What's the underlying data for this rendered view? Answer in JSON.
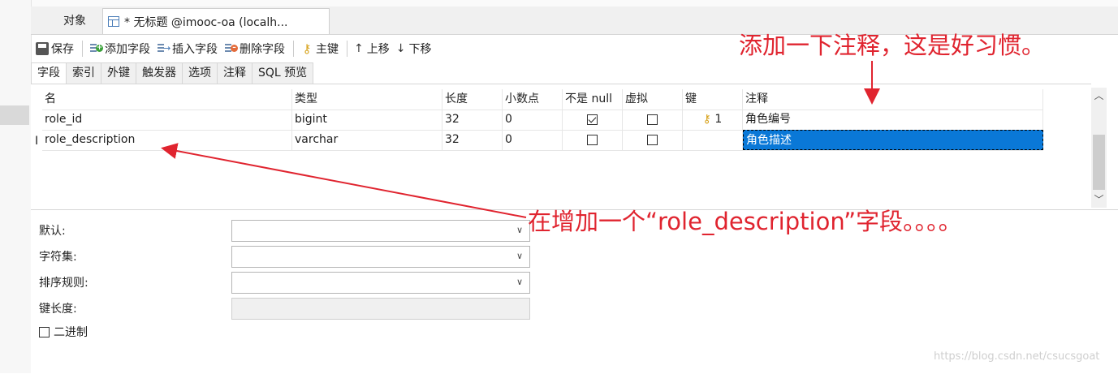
{
  "tabs": {
    "objects_label": "对象",
    "document_label": "* 无标题 @imooc-oa (localh..."
  },
  "toolbar": {
    "save": "保存",
    "add_field": "添加字段",
    "insert_field": "插入字段",
    "delete_field": "删除字段",
    "primary_key": "主键",
    "move_up": "上移",
    "move_down": "下移"
  },
  "subtabs": [
    "字段",
    "索引",
    "外键",
    "触发器",
    "选项",
    "注释",
    "SQL 预览"
  ],
  "grid": {
    "headers": [
      "名",
      "类型",
      "长度",
      "小数点",
      "不是 null",
      "虚拟",
      "键",
      "注释"
    ],
    "rows": [
      {
        "name": "role_id",
        "type": "bigint",
        "length": "32",
        "decimals": "0",
        "not_null": true,
        "virtual": false,
        "key": "1",
        "comment": "角色编号"
      },
      {
        "name": "role_description",
        "type": "varchar",
        "length": "32",
        "decimals": "0",
        "not_null": false,
        "virtual": false,
        "key": "",
        "comment": "角色描述"
      }
    ]
  },
  "properties": {
    "default_label": "默认:",
    "charset_label": "字符集:",
    "collation_label": "排序规则:",
    "key_length_label": "键长度:",
    "binary_label": "二进制"
  },
  "annotations": {
    "top": "添加一下注释，这是好习惯。",
    "middle": "在增加一个“role_description”字段。。。。"
  },
  "watermark": "https://blog.csdn.net/csucsgoat",
  "colors": {
    "annotation": "#e0242f",
    "selection": "#0a78d7",
    "key_icon": "#d7a21a"
  }
}
